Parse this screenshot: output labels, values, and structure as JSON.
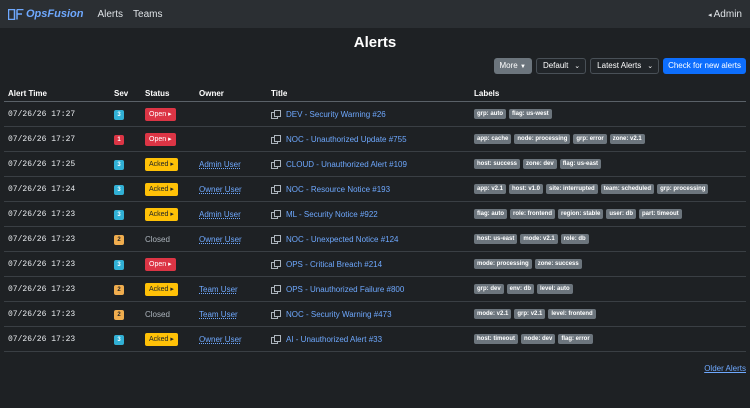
{
  "nav": {
    "brand": "OpsFusion",
    "links": [
      "Alerts",
      "Teams"
    ],
    "user": "Admin"
  },
  "page": {
    "title": "Alerts"
  },
  "toolbar": {
    "more": "More",
    "default_select": "Default",
    "sort_select": "Latest Alerts",
    "check_button": "Check for new alerts"
  },
  "table": {
    "headers": [
      "Alert Time",
      "Sev",
      "Status",
      "Owner",
      "Title",
      "Labels"
    ],
    "rows": [
      {
        "time": "07/26/26 17:27",
        "sev": "3",
        "status": "Open",
        "owner": "",
        "title": "DEV - Security Warning #26",
        "labels": [
          "grp: auto",
          "flag: us-west"
        ]
      },
      {
        "time": "07/26/26 17:27",
        "sev": "1",
        "status": "Open",
        "owner": "",
        "title": "NOC - Unauthorized Update #755",
        "labels": [
          "app: cache",
          "node: processing",
          "grp: error",
          "zone: v2.1"
        ]
      },
      {
        "time": "07/26/26 17:25",
        "sev": "3",
        "status": "Acked",
        "owner": "Admin User",
        "title": "CLOUD - Unauthorized Alert #109",
        "labels": [
          "host: success",
          "zone: dev",
          "flag: us-east"
        ]
      },
      {
        "time": "07/26/26 17:24",
        "sev": "3",
        "status": "Acked",
        "owner": "Owner User",
        "title": "NOC - Resource Notice #193",
        "labels": [
          "app: v2.1",
          "host: v1.0",
          "site: interrupted",
          "team: scheduled",
          "grp: processing"
        ]
      },
      {
        "time": "07/26/26 17:23",
        "sev": "3",
        "status": "Acked",
        "owner": "Admin User",
        "title": "ML - Security Notice #922",
        "labels": [
          "flag: auto",
          "role: frontend",
          "region: stable",
          "user: db",
          "part: timeout"
        ]
      },
      {
        "time": "07/26/26 17:23",
        "sev": "2",
        "status": "Closed",
        "owner": "Owner User",
        "title": "NOC - Unexpected Notice #124",
        "labels": [
          "host: us-east",
          "mode: v2.1",
          "role: db"
        ]
      },
      {
        "time": "07/26/26 17:23",
        "sev": "3",
        "status": "Open",
        "owner": "",
        "title": "OPS - Critical Breach #214",
        "labels": [
          "mode: processing",
          "zone: success"
        ]
      },
      {
        "time": "07/26/26 17:23",
        "sev": "2",
        "status": "Acked",
        "owner": "Team User",
        "title": "OPS - Unauthorized Failure #800",
        "labels": [
          "grp: dev",
          "env: db",
          "level: auto"
        ]
      },
      {
        "time": "07/26/26 17:23",
        "sev": "2",
        "status": "Closed",
        "owner": "Team User",
        "title": "NOC - Security Warning #473",
        "labels": [
          "mode: v2.1",
          "grp: v2.1",
          "level: frontend"
        ]
      },
      {
        "time": "07/26/26 17:23",
        "sev": "3",
        "status": "Acked",
        "owner": "Owner User",
        "title": "AI - Unauthorized Alert #33",
        "labels": [
          "host: timeout",
          "node: dev",
          "flag: error"
        ]
      }
    ]
  },
  "pagination": {
    "older": "Older Alerts"
  }
}
